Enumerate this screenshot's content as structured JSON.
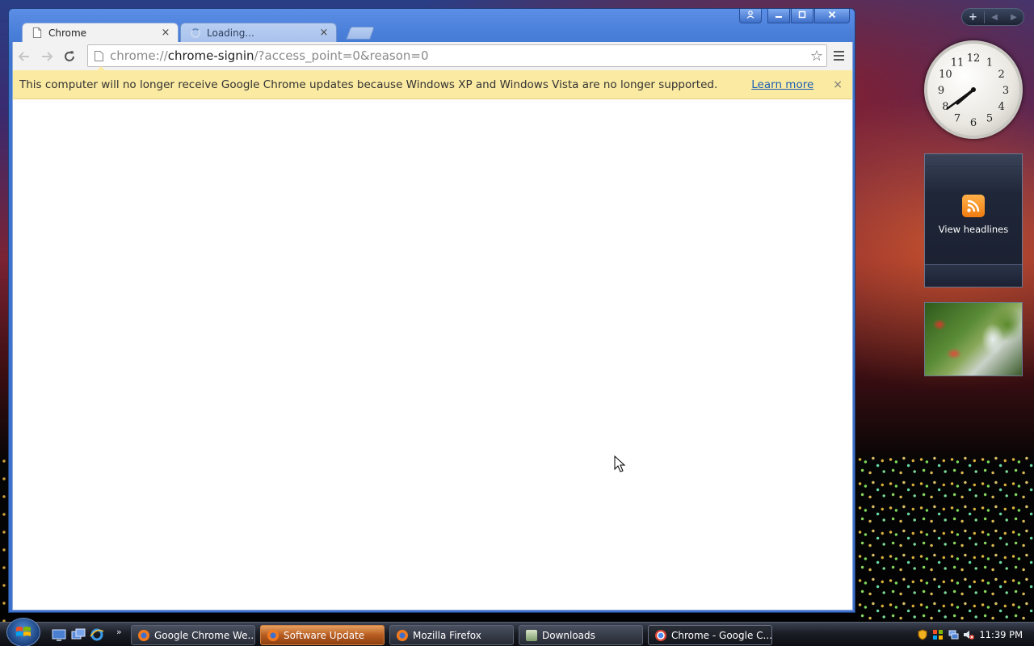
{
  "browser": {
    "tabs": [
      {
        "title": "Chrome",
        "active": true
      },
      {
        "title": "Loading...",
        "active": false
      }
    ],
    "omnibox": {
      "scheme": "chrome://",
      "host": "chrome-signin",
      "rest": "/?access_point=0&reason=0"
    },
    "infobar": {
      "message": "This computer will no longer receive Google Chrome updates because Windows XP and Windows Vista are no longer supported.",
      "link": "Learn more",
      "close": "×"
    },
    "tab_close": "×"
  },
  "gadgets": {
    "clock_numbers": [
      "12",
      "1",
      "2",
      "3",
      "4",
      "5",
      "6",
      "7",
      "8",
      "9",
      "10",
      "11"
    ],
    "clock_time": {
      "hour": 7,
      "minute": 39
    },
    "rss_label": "View headlines"
  },
  "taskbar": {
    "buttons": [
      {
        "label": "Google Chrome We...",
        "icon": "firefox-icon"
      },
      {
        "label": "Software Update",
        "icon": "firefox-icon"
      },
      {
        "label": "Mozilla Firefox",
        "icon": "firefox-icon"
      },
      {
        "label": "Downloads",
        "icon": "folder-icon"
      },
      {
        "label": "Chrome - Google C...",
        "icon": "chrome-icon"
      }
    ],
    "time": "11:39 PM"
  },
  "colors": {
    "infobar_bg": "#fbeaa2",
    "link": "#1a5fb4",
    "window_frame": "#4a7fd9"
  }
}
